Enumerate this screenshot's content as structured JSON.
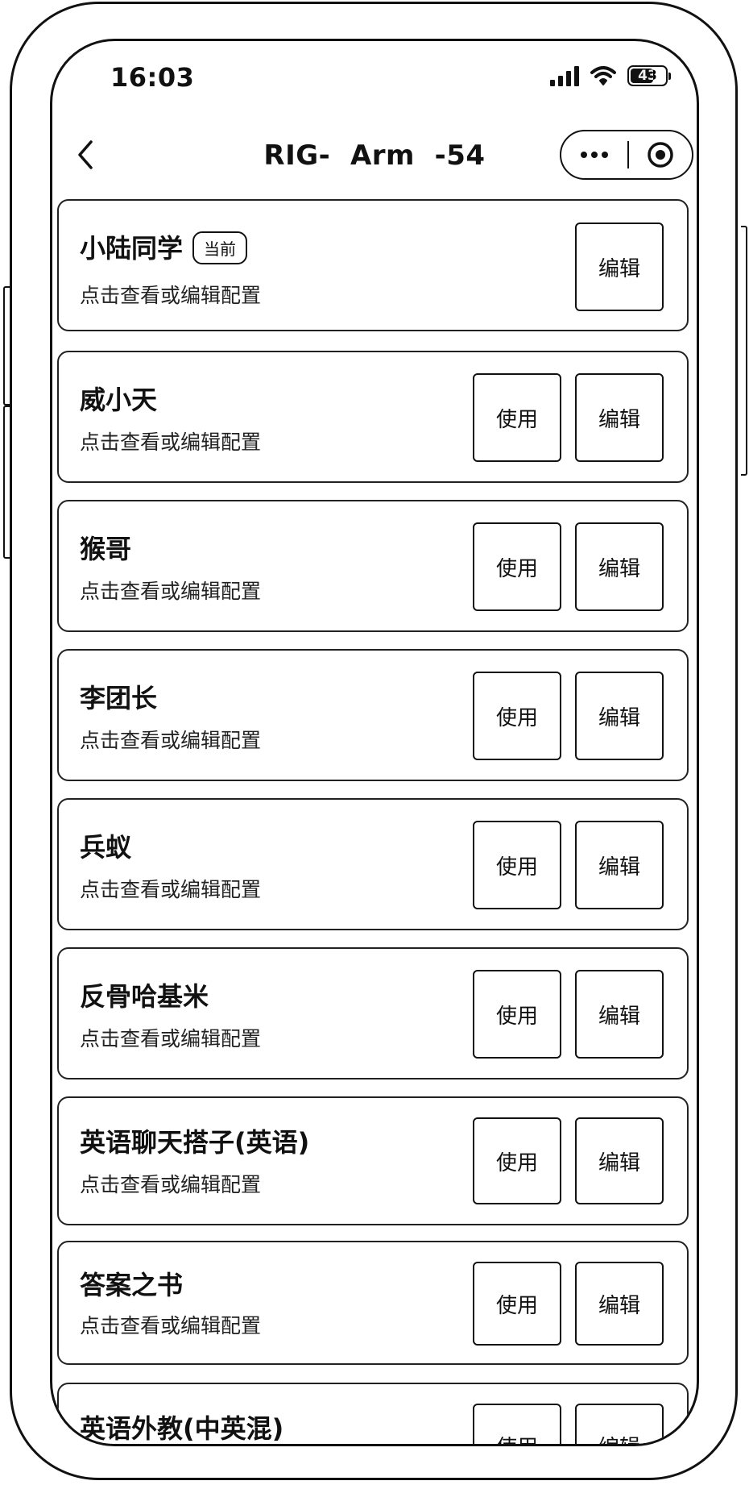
{
  "status_bar": {
    "time": "16:03",
    "battery_level": "43"
  },
  "nav": {
    "title": "RIG-  Arm  -54"
  },
  "list": {
    "desc": "点击查看或编辑配置",
    "current_badge": "当前",
    "use_label": "使用",
    "edit_label": "编辑",
    "items": [
      {
        "name": "小陆同学"
      },
      {
        "name": "威小天"
      },
      {
        "name": "猴哥"
      },
      {
        "name": "李团长"
      },
      {
        "name": "兵蚁"
      },
      {
        "name": "反骨哈基米"
      },
      {
        "name": "英语聊天搭子(英语)"
      },
      {
        "name": "答案之书"
      },
      {
        "name": "英语外教(中英混)"
      }
    ]
  }
}
